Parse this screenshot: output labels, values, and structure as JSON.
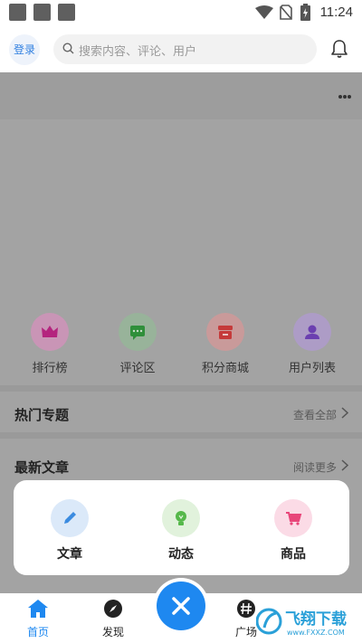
{
  "status_bar": {
    "time": "11:24"
  },
  "header": {
    "login_label": "登录",
    "search_placeholder": "搜索内容、评论、用户"
  },
  "shortcuts": [
    {
      "label": "排行榜",
      "color": "#c06cb0"
    },
    {
      "label": "评论区",
      "color": "#4caf50"
    },
    {
      "label": "积分商城",
      "color": "#e35a5a"
    },
    {
      "label": "用户列表",
      "color": "#8a5dd0"
    }
  ],
  "sections": {
    "hot_topics": {
      "title": "热门专题",
      "link": "查看全部"
    },
    "latest_articles": {
      "title": "最新文章",
      "link": "阅读更多"
    }
  },
  "sheet": {
    "items": [
      {
        "label": "文章",
        "color": "#3b8be0"
      },
      {
        "label": "动态",
        "color": "#55b84a"
      },
      {
        "label": "商品",
        "color": "#e8467a"
      }
    ]
  },
  "nav": {
    "items": [
      {
        "label": "首页",
        "active": true
      },
      {
        "label": "发现",
        "active": false
      },
      {
        "label": "广场",
        "active": false
      }
    ],
    "accent": "#1e88f0"
  },
  "watermark": {
    "text": "飞翔下载",
    "sub": "www.FXXZ.COM"
  }
}
